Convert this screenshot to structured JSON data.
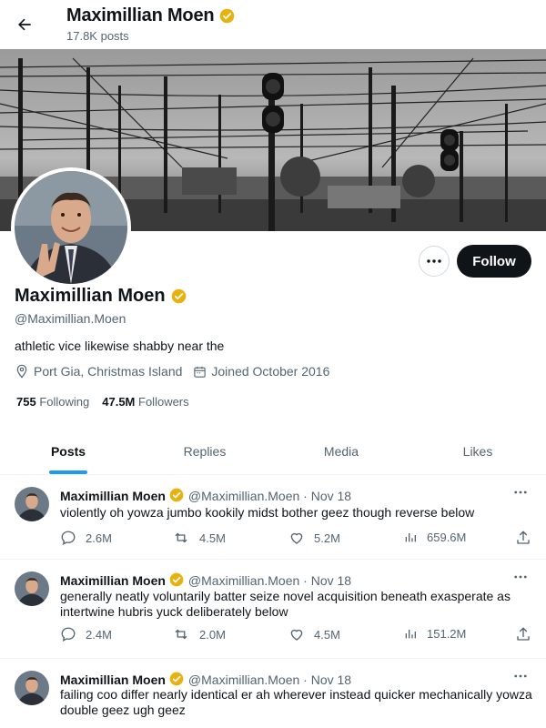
{
  "header": {
    "title": "Maximillian Moen",
    "posts_count": "17.8K posts"
  },
  "profile": {
    "name": "Maximillian Moen",
    "handle": "@Maximillian.Moen",
    "bio": "athletic vice likewise shabby near the",
    "location": "Port Gia, Christmas Island",
    "joined": "Joined October 2016",
    "following_count": "755",
    "following_label": "Following",
    "followers_count": "47.5M",
    "followers_label": "Followers",
    "follow_label": "Follow"
  },
  "tabs": [
    {
      "label": "Posts",
      "active": true
    },
    {
      "label": "Replies",
      "active": false
    },
    {
      "label": "Media",
      "active": false
    },
    {
      "label": "Likes",
      "active": false
    }
  ],
  "posts": [
    {
      "name": "Maximillian Moen",
      "handle_date": "@Maximillian.Moen · Nov 18",
      "text": "violently oh yowza jumbo kookily midst bother geez though reverse below",
      "replies": "2.6M",
      "reposts": "4.5M",
      "likes": "5.2M",
      "views": "659.6M"
    },
    {
      "name": "Maximillian Moen",
      "handle_date": "@Maximillian.Moen · Nov 18",
      "text": "generally neatly voluntarily batter seize novel acquisition beneath exasperate as intertwine hubris yuck deliberately below",
      "replies": "2.4M",
      "reposts": "2.0M",
      "likes": "4.5M",
      "views": "151.2M"
    },
    {
      "name": "Maximillian Moen",
      "handle_date": "@Maximillian.Moen · Nov 18",
      "text": "failing coo differ nearly identical er ah wherever instead quicker mechanically yowza double geez ugh geez"
    }
  ],
  "colors": {
    "verified_gold": "#e8b10e",
    "accent_blue": "#1d9bf0",
    "follow_bg": "#0f1419"
  },
  "icons": {
    "back": "arrow-left-icon",
    "verified": "verified-badge-icon",
    "more": "ellipsis-icon",
    "location": "location-pin-icon",
    "calendar": "calendar-icon",
    "reply": "reply-icon",
    "repost": "repost-icon",
    "like": "heart-icon",
    "views": "views-bar-icon",
    "share": "share-icon"
  }
}
